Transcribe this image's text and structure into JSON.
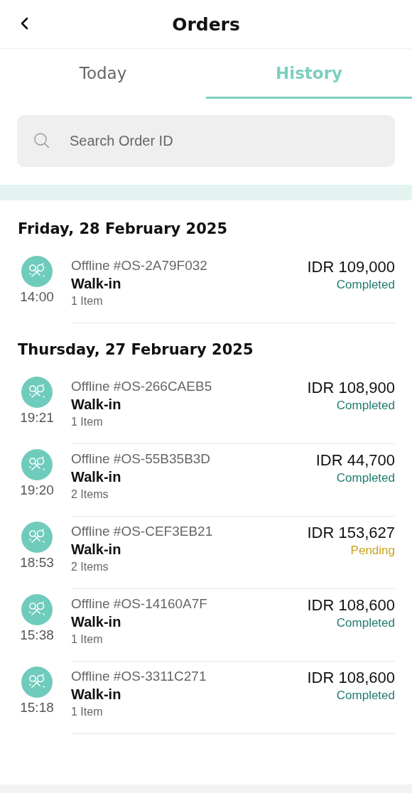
{
  "header": {
    "title": "Orders"
  },
  "tabs": [
    {
      "label": "Today",
      "selected": false
    },
    {
      "label": "History",
      "selected": true
    }
  ],
  "search": {
    "placeholder": "Search Order ID"
  },
  "days": [
    {
      "date": "Friday, 28 February 2025",
      "orders": [
        {
          "time": "14:00",
          "id": "Offline #OS-2A79F032",
          "customer": "Walk-in",
          "items": "1 Item",
          "total": "IDR 109,000",
          "status": "Completed",
          "pending": false
        }
      ]
    },
    {
      "date": "Thursday, 27 February 2025",
      "orders": [
        {
          "time": "19:21",
          "id": "Offline #OS-266CAEB5",
          "customer": "Walk-in",
          "items": "1 Item",
          "total": "IDR 108,900",
          "status": "Completed",
          "pending": false
        },
        {
          "time": "19:20",
          "id": "Offline #OS-55B35B3D",
          "customer": "Walk-in",
          "items": "2 Items",
          "total": "IDR 44,700",
          "status": "Completed",
          "pending": false
        },
        {
          "time": "18:53",
          "id": "Offline #OS-CEF3EB21",
          "customer": "Walk-in",
          "items": "2 Items",
          "total": "IDR 153,627",
          "status": "Pending",
          "pending": true
        },
        {
          "time": "15:38",
          "id": "Offline #OS-14160A7F",
          "customer": "Walk-in",
          "items": "1 Item",
          "total": "IDR 108,600",
          "status": "Completed",
          "pending": false
        },
        {
          "time": "15:18",
          "id": "Offline #OS-3311C271",
          "customer": "Walk-in",
          "items": "1 Item",
          "total": "IDR 108,600",
          "status": "Completed",
          "pending": false
        }
      ]
    }
  ]
}
